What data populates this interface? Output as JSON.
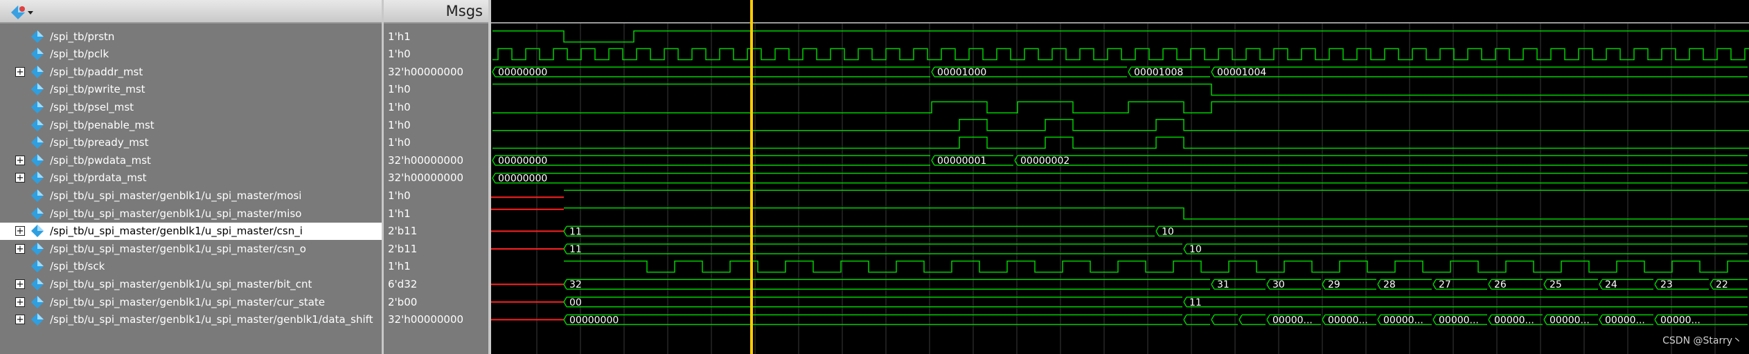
{
  "header": {
    "msgs_label": "Msgs",
    "toolbar_icon": "wave-signal-icon"
  },
  "signals": [
    {
      "name": "/spi_tb/prstn",
      "value": "1'h1",
      "expandable": false
    },
    {
      "name": "/spi_tb/pclk",
      "value": "1'h0",
      "expandable": false
    },
    {
      "name": "/spi_tb/paddr_mst",
      "value": "32'h00000000",
      "expandable": true
    },
    {
      "name": "/spi_tb/pwrite_mst",
      "value": "1'h0",
      "expandable": false
    },
    {
      "name": "/spi_tb/psel_mst",
      "value": "1'h0",
      "expandable": false
    },
    {
      "name": "/spi_tb/penable_mst",
      "value": "1'h0",
      "expandable": false
    },
    {
      "name": "/spi_tb/pready_mst",
      "value": "1'h0",
      "expandable": false
    },
    {
      "name": "/spi_tb/pwdata_mst",
      "value": "32'h00000000",
      "expandable": true
    },
    {
      "name": "/spi_tb/prdata_mst",
      "value": "32'h00000000",
      "expandable": true
    },
    {
      "name": "/spi_tb/u_spi_master/genblk1/u_spi_master/mosi",
      "value": "1'h0",
      "expandable": false
    },
    {
      "name": "/spi_tb/u_spi_master/genblk1/u_spi_master/miso",
      "value": "1'h1",
      "expandable": false
    },
    {
      "name": "/spi_tb/u_spi_master/genblk1/u_spi_master/csn_i",
      "value": "2'b11",
      "expandable": true,
      "selected": true
    },
    {
      "name": "/spi_tb/u_spi_master/genblk1/u_spi_master/csn_o",
      "value": "2'b11",
      "expandable": true
    },
    {
      "name": "/spi_tb/sck",
      "value": "1'h1",
      "expandable": false
    },
    {
      "name": "/spi_tb/u_spi_master/genblk1/u_spi_master/bit_cnt",
      "value": "6'd32",
      "expandable": true
    },
    {
      "name": "/spi_tb/u_spi_master/genblk1/u_spi_master/cur_state",
      "value": "2'b00",
      "expandable": true
    },
    {
      "name": "/spi_tb/u_spi_master/genblk1/u_spi_master/genblk1/data_shift",
      "value": "32'h00000000",
      "expandable": true
    }
  ],
  "bus_labels": {
    "paddr": [
      "00000000",
      "00001000",
      "00001008",
      "00001004"
    ],
    "pwdata": [
      "00000000",
      "00000001",
      "00000002"
    ],
    "prdata": [
      "00000000"
    ],
    "csn_i": [
      "11",
      "10"
    ],
    "csn_o": [
      "11",
      "10"
    ],
    "bit_cnt": [
      "32",
      "31",
      "30",
      "29",
      "28",
      "27",
      "26",
      "25",
      "24",
      "23",
      "22"
    ],
    "cur_state": [
      "00",
      "11"
    ],
    "data_shift": [
      "00000000",
      "00000...",
      "00000...",
      "00000...",
      "00000...",
      "00000...",
      "00000...",
      "00000...",
      "00000..."
    ]
  },
  "watermark": "CSDN @Starry丶",
  "colors": {
    "wave": "#00d000",
    "undefined": "#ff2020",
    "cursor": "#ffcc00"
  }
}
